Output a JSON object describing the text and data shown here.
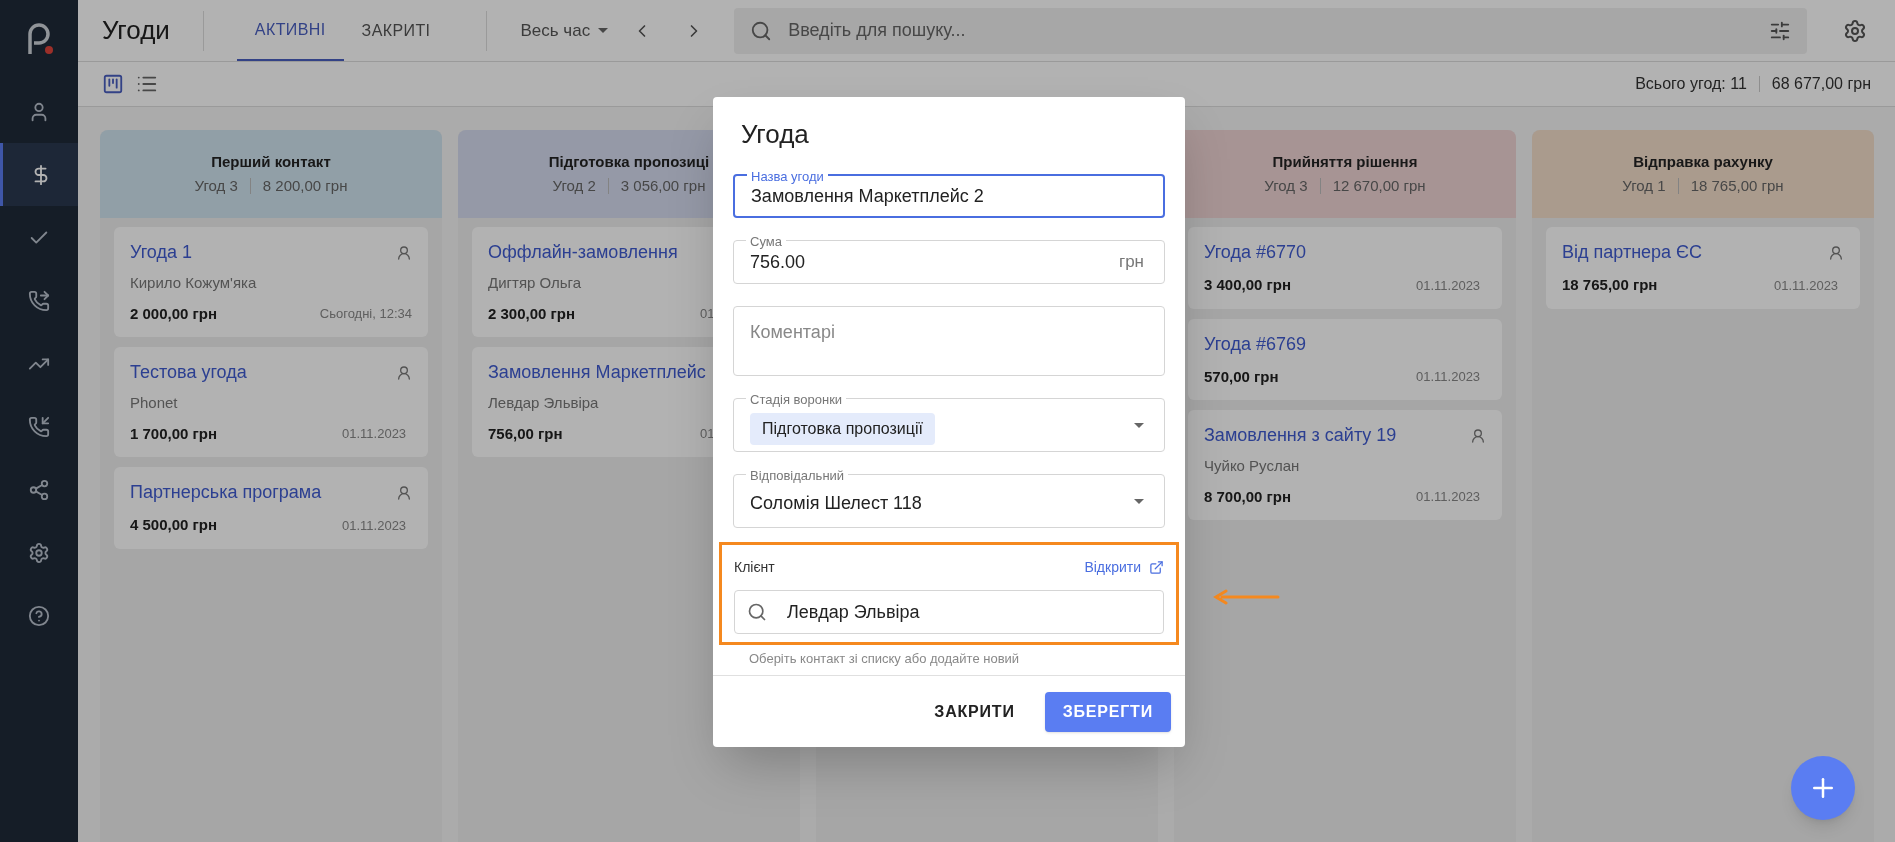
{
  "sidebar": {
    "items": [
      {
        "kind": "person",
        "selected": false
      },
      {
        "kind": "dollar",
        "selected": true
      },
      {
        "kind": "check",
        "selected": false
      },
      {
        "kind": "call-list",
        "selected": false
      },
      {
        "kind": "chart",
        "selected": false
      },
      {
        "kind": "phone",
        "selected": false
      },
      {
        "kind": "flow",
        "selected": false
      },
      {
        "kind": "settings",
        "selected": false
      },
      {
        "kind": "help",
        "selected": false
      }
    ]
  },
  "header": {
    "title": "Угоди",
    "tabs": [
      {
        "label": "АКТИВНІ",
        "selected": true
      },
      {
        "label": "ЗАКРИТІ",
        "selected": false
      }
    ],
    "period": "Весь час",
    "search": {
      "placeholder": "Введіть для пошуку..."
    }
  },
  "toolbar": {
    "views": [
      {
        "kind": "board",
        "selected": true
      },
      {
        "kind": "list",
        "selected": false
      }
    ],
    "total_count": "Всього угод: 11",
    "total_sum": "68 677,00 грн"
  },
  "columns": [
    {
      "title": "Перший контакт",
      "count": "Угод 3",
      "sum": "8 200,00 грн",
      "color": "#919fa7",
      "cards": [
        {
          "title": "Угода 1",
          "contact": "Кирило Кожум'яка",
          "amount": "2 000,00 грн",
          "date": "Сьогодні, 12:34",
          "person_icon": true
        },
        {
          "title": "Тестова угода",
          "contact": "Phonet",
          "amount": "1 700,00 грн",
          "date": "01.11.2023",
          "person_icon": true
        },
        {
          "title": "Партнерська програма",
          "amount": "4 500,00 грн",
          "date": "01.11.2023",
          "person_icon": true
        }
      ]
    },
    {
      "title": "Підготовка пропозиці",
      "count": "Угод 2",
      "sum": "3 056,00 грн",
      "color": "#9599a7",
      "cards": [
        {
          "title": "Оффлайн-замовлення",
          "contact": "Дигтяр Ольга",
          "amount": "2 300,00 грн",
          "date": "01",
          "person_icon": false
        },
        {
          "title": "Замовлення Маркетплейс",
          "contact": "Левдар Эльвіра",
          "amount": "756,00 грн",
          "date": "01",
          "person_icon": false
        }
      ]
    },
    {},
    {
      "title": "Прийняття рішення",
      "count": "Угод 3",
      "sum": "12 670,00 грн",
      "color": "#a79494",
      "cards": [
        {
          "title": "Угода #6770",
          "amount": "3 400,00 грн",
          "date": "01.11.2023",
          "person_icon": false
        },
        {
          "title": "Угода #6769",
          "amount": "570,00 грн",
          "date": "01.11.2023",
          "person_icon": false
        },
        {
          "title": "Замовлення з сайту 19",
          "contact": "Чуйко Руслан",
          "amount": "8 700,00 грн",
          "date": "01.11.2023",
          "person_icon": true
        }
      ]
    },
    {
      "title": "Відправка рахунку",
      "count": "Угод 1",
      "sum": "18 765,00 грн",
      "color": "#aa9b8d",
      "cards": [
        {
          "title": "Від партнера ЄС",
          "amount": "18 765,00 грн",
          "date": "01.11.2023",
          "person_icon": true
        }
      ]
    }
  ],
  "dialog": {
    "title": "Угода",
    "fields": [
      {
        "kind": "text",
        "label": "Назва угоди",
        "value": "Замовлення Маркетплейс 2",
        "focused": true
      },
      {
        "kind": "text",
        "label": "Сума",
        "value": "756.00",
        "suffix": "грн",
        "focused": false
      },
      {
        "kind": "textarea",
        "placeholder": "Коментарі",
        "focused": false
      },
      {
        "kind": "chip-select",
        "label": "Стадія воронки",
        "value": "Підготовка пропозиції",
        "focused": false
      },
      {
        "kind": "select",
        "label": "Відповідальний",
        "value": "Соломія Шелест 118",
        "focused": false
      }
    ],
    "client": {
      "label": "Клієнт",
      "link": "Відкрити",
      "value": "Левдар Эльвіра",
      "helper": "Оберіть контакт зі списку або додайте новий",
      "highlighted": true
    },
    "buttons": [
      {
        "kind": "text",
        "label": "ЗАКРИТИ"
      },
      {
        "kind": "primary",
        "label": "ЗБЕРЕГТИ"
      }
    ]
  }
}
